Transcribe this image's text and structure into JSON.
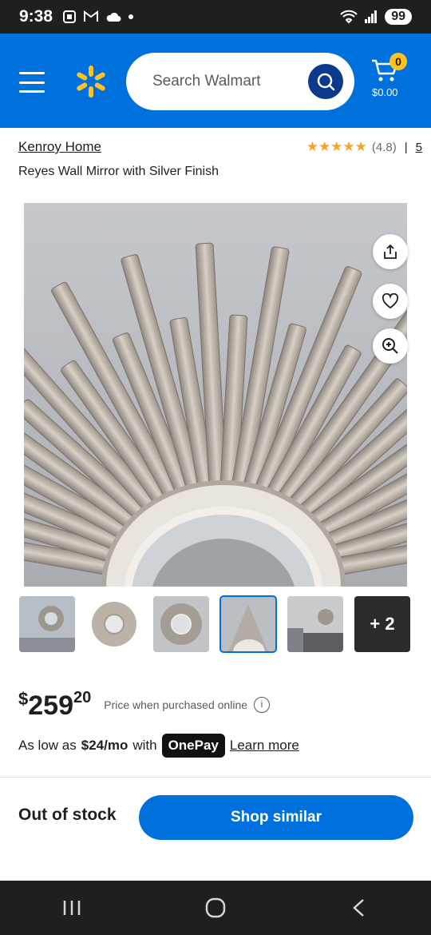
{
  "status_bar": {
    "time": "9:38",
    "battery": "99"
  },
  "header": {
    "search_placeholder": "Search Walmart",
    "cart_count": "0",
    "cart_total": "$0.00",
    "brand_color": "#0071dc",
    "spark_color": "#ffc220"
  },
  "product": {
    "brand": "Kenroy Home",
    "rating_value": "(4.8)",
    "stars": "★★★★★",
    "separator": "|",
    "review_count": "5",
    "title": "Reyes Wall Mirror with Silver Finish"
  },
  "thumbnails": {
    "more_label": "+ 2"
  },
  "price": {
    "currency": "$",
    "dollars": "259",
    "cents": "20",
    "note": "Price when purchased online",
    "info_icon": "i"
  },
  "financing": {
    "prefix": "As low as",
    "amount": "$24/mo",
    "with": "with",
    "provider": "OnePay",
    "link": "Learn more"
  },
  "availability": {
    "status": "Out of stock",
    "action": "Shop similar"
  },
  "icons": [
    "menu-icon",
    "spark-logo-icon",
    "search-icon",
    "cart-icon",
    "share-icon",
    "heart-icon",
    "zoom-icon",
    "info-icon",
    "recents-icon",
    "home-icon",
    "back-icon"
  ]
}
